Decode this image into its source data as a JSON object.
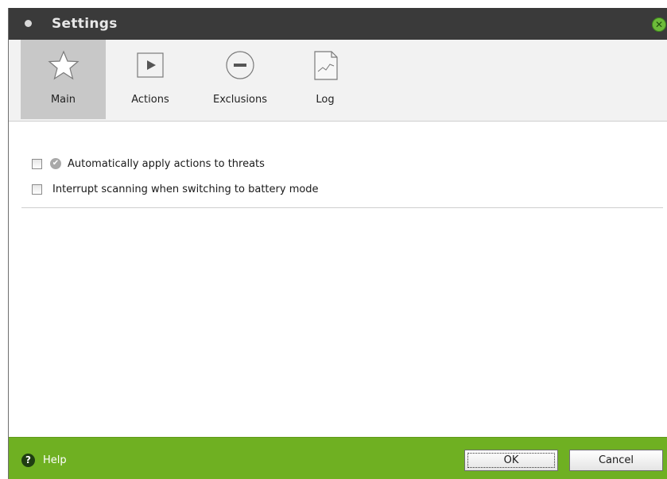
{
  "window": {
    "title": "Settings",
    "accent_color": "#6fb022",
    "titlebar_color": "#3a3a3a"
  },
  "tabs": [
    {
      "label": "Main",
      "icon": "star-icon",
      "active": true
    },
    {
      "label": "Actions",
      "icon": "play-icon",
      "active": false
    },
    {
      "label": "Exclusions",
      "icon": "minus-circle-icon",
      "active": false
    },
    {
      "label": "Log",
      "icon": "log-document-icon",
      "active": false
    }
  ],
  "options": [
    {
      "label": "Automatically apply actions to threats",
      "checked": false,
      "icon": "check-circle-icon"
    },
    {
      "label": "Interrupt scanning when switching to battery mode",
      "checked": false
    }
  ],
  "footer": {
    "help_label": "Help",
    "ok_label": "OK",
    "cancel_label": "Cancel"
  }
}
